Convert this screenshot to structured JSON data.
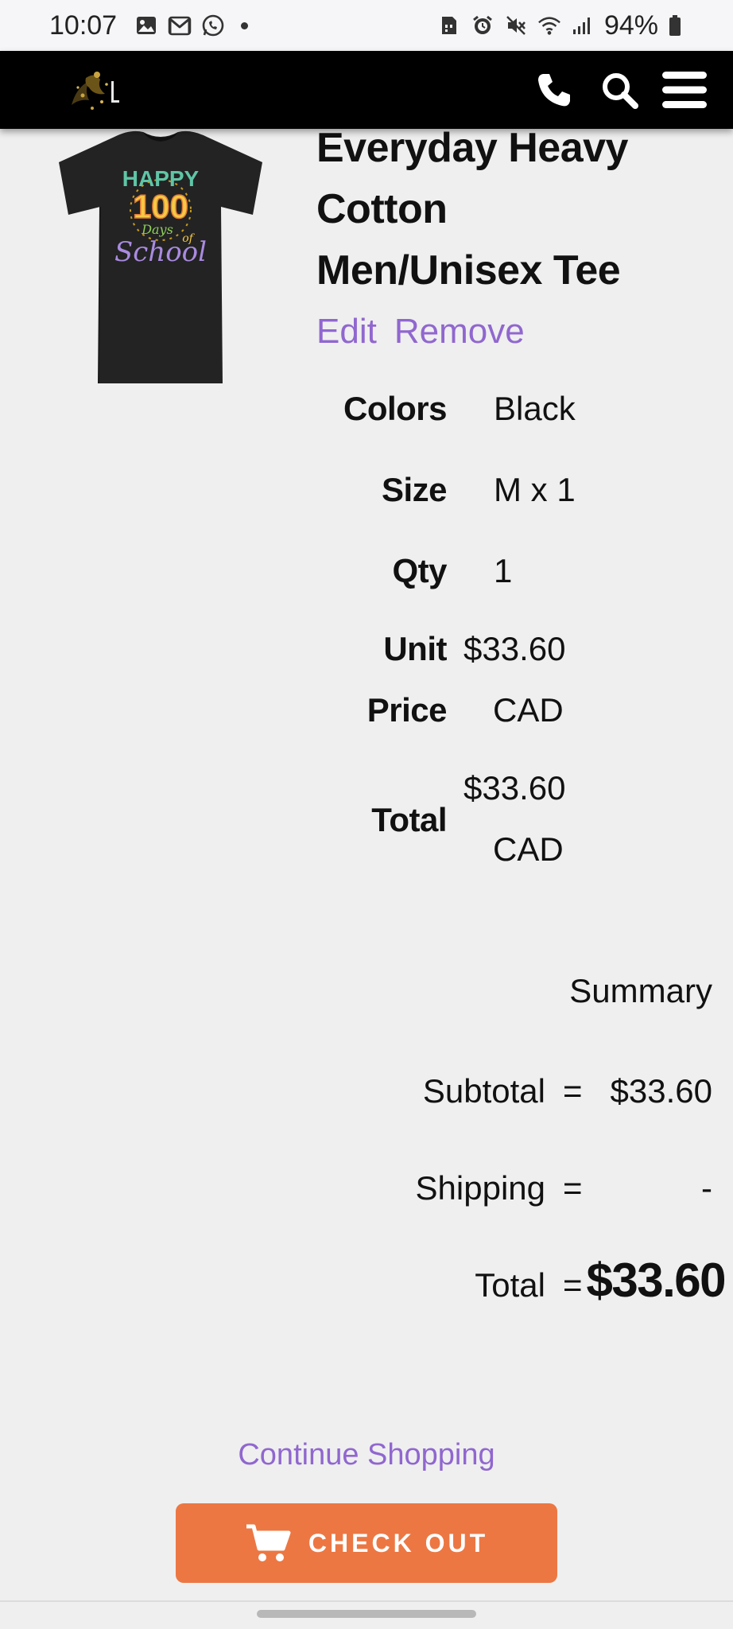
{
  "status_bar": {
    "time": "10:07",
    "battery": "94%",
    "left_icons": [
      "gallery-icon",
      "gmail-icon",
      "whatsapp-icon"
    ],
    "right_icons": [
      "sim-icon",
      "alarm-icon",
      "mute-icon",
      "wifi-icon",
      "signal-icon",
      "battery-icon"
    ]
  },
  "navbar": {
    "icons": [
      "phone-icon",
      "search-icon",
      "menu-icon"
    ]
  },
  "product": {
    "title_lines": [
      "Everyday Heavy",
      "Cotton",
      "Men/Unisex Tee"
    ],
    "actions": {
      "edit": "Edit",
      "remove": "Remove"
    },
    "image_text": {
      "line1": "HAPPY",
      "line2": "100",
      "line3": "Days",
      "line4": "of",
      "line5": "School"
    },
    "attributes": {
      "colors": {
        "label": "Colors",
        "value": "Black"
      },
      "size": {
        "label": "Size",
        "value": "M x 1"
      },
      "qty": {
        "label": "Qty",
        "value": "1"
      },
      "unit_price": {
        "label_line1": "Unit",
        "label_line2": "Price",
        "value_line1": "$33.60",
        "value_line2": "CAD"
      },
      "total": {
        "label": "Total",
        "value_line1": "$33.60",
        "value_line2": "CAD"
      }
    }
  },
  "summary": {
    "title": "Summary",
    "subtotal": {
      "label": "Subtotal",
      "eq": "=",
      "value": "$33.60"
    },
    "shipping": {
      "label": "Shipping",
      "eq": "=",
      "value": "-"
    },
    "total": {
      "label": "Total",
      "eq": "=",
      "value": "$33.60"
    }
  },
  "actions": {
    "continue_shopping": "Continue Shopping",
    "checkout": "CHECK OUT"
  },
  "colors": {
    "accent_purple": "#9067cf",
    "checkout_orange": "#ec7743",
    "navbar_black": "#000000",
    "page_background": "#efefef"
  }
}
